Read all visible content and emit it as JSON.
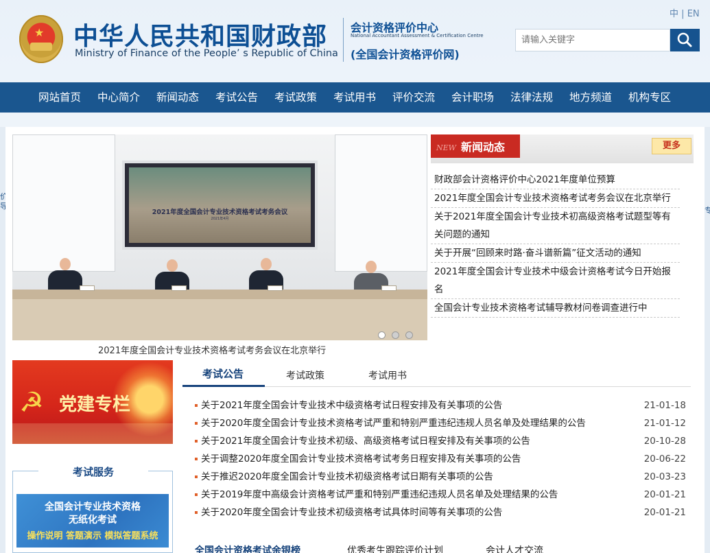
{
  "header": {
    "title_cn": "中华人民共和国财政部",
    "title_en": "Ministry of Finance of the People’ s Republic of China",
    "center_cn": "会计资格评价中心",
    "center_en": "National Accountant Assessment & Certification Centre",
    "center_net": "(全国会计资格评价网)",
    "lang_cn": "中",
    "lang_sep": "|",
    "lang_en": "EN",
    "search": {
      "placeholder": "请输入关键字"
    }
  },
  "nav": {
    "items": [
      "网站首页",
      "中心简介",
      "新闻动态",
      "考试公告",
      "考试政策",
      "考试用书",
      "评价交流",
      "会计职场",
      "法律法规",
      "地方频道",
      "机构专区"
    ]
  },
  "side": {
    "left_glyphs": "价\n导",
    "right_glyph": "专"
  },
  "slideshow": {
    "screen_title": "2021年度全国会计专业技术资格考试考务会议",
    "screen_sub": "2021年4月",
    "caption": "2021年度全国会计专业技术资格考试考务会议在北京举行"
  },
  "news": {
    "tag_new": "NEW",
    "title": "新闻动态",
    "more": "更多",
    "items": [
      "财政部会计资格评价中心2021年度单位预算",
      "2021年度全国会计专业技术资格考试考务会议在北京举行",
      "关于2021年度全国会计专业技术初高级资格考试题型等有关问题的通知",
      "关于开展“回顾来时路·奋斗谱新篇”征文活动的通知",
      "2021年度全国会计专业技术中级会计资格考试今日开始报名",
      "全国会计专业技术资格考试辅导教材问卷调查进行中"
    ]
  },
  "party": {
    "label": "党建专栏"
  },
  "service": {
    "title": "考试服务",
    "banner_l1": "全国会计专业技术资格",
    "banner_l2": "无纸化考试",
    "banner_l3": "操作说明 答题演示 模拟答题系统"
  },
  "notices": {
    "tabs": [
      "考试公告",
      "考试政策",
      "考试用书"
    ],
    "rows": [
      {
        "text": "关于2021年度全国会计专业技术中级资格考试日程安排及有关事项的公告",
        "date": "21-01-18"
      },
      {
        "text": "关于2020年度全国会计专业技术资格考试严重和特别严重违纪违规人员名单及处理结果的公告",
        "date": "21-01-12"
      },
      {
        "text": "关于2021年度全国会计专业技术初级、高级资格考试日程安排及有关事项的公告",
        "date": "20-10-28"
      },
      {
        "text": "关于调整2020年度全国会计专业技术资格考试考务日程安排及有关事项的公告",
        "date": "20-06-22"
      },
      {
        "text": "关于推迟2020年度全国会计专业技术初级资格考试日期有关事项的公告",
        "date": "20-03-23"
      },
      {
        "text": "关于2019年度中高级会计资格考试严重和特别严重违纪违规人员名单及处理结果的公告",
        "date": "20-01-21"
      },
      {
        "text": "关于2020年度全国会计专业技术初级资格考试具体时间等有关事项的公告",
        "date": "20-01-21"
      }
    ]
  },
  "bottom_tabs": [
    "全国会计资格考试余银榜",
    "优秀考生跟踪评价计划",
    "会计人才交流"
  ],
  "colors": {
    "nav_bg": "#1a568f",
    "title_blue": "#0d4f94",
    "news_red": "#c92a22",
    "notice_bullet": "#e0602a"
  }
}
